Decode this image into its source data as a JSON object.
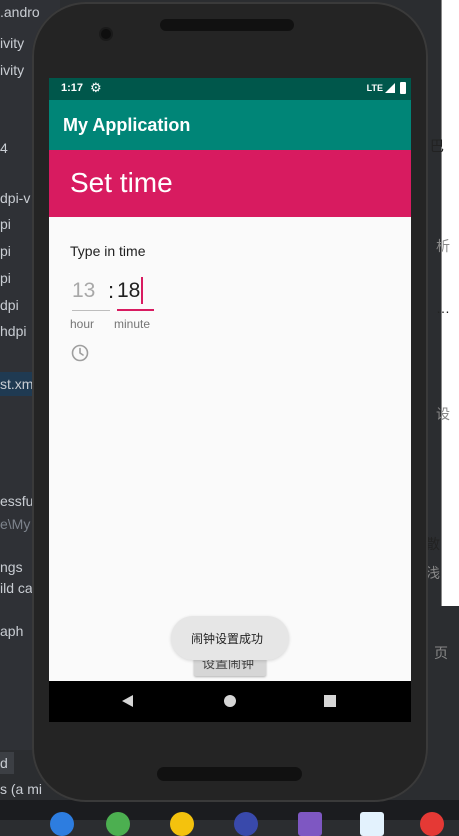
{
  "ide": {
    "left_lines": [
      ".andro",
      "ivity",
      "ivity",
      "4",
      "dpi-v",
      "pi",
      "pi",
      "pi",
      "dpi",
      "hdpi",
      "st.xm",
      "essfu",
      "e\\My",
      "ngs",
      "ild ca",
      "aph"
    ],
    "right_lines": [
      "巴",
      "析",
      "…",
      "设",
      "散",
      "浅",
      "页"
    ],
    "bottom_lines": [
      "d",
      "s (a mi"
    ]
  },
  "status_bar": {
    "time": "1:17",
    "network": "LTE"
  },
  "app_bar": {
    "title": "My Application"
  },
  "time_picker": {
    "title": "Set time",
    "input_label": "Type in time",
    "hour_value": "13",
    "minute_value": "18",
    "separator": ":",
    "hour_caption": "hour",
    "minute_caption": "minute"
  },
  "button": {
    "label": "设置闹钟"
  },
  "toast": {
    "message": "闹钟设置成功"
  },
  "colors": {
    "status_bar": "#00574b",
    "app_bar": "#008577",
    "accent": "#d81b60"
  },
  "icons": [
    "gear-icon",
    "signal-icon",
    "battery-icon",
    "clock-icon",
    "back-icon",
    "home-icon",
    "recents-icon"
  ]
}
